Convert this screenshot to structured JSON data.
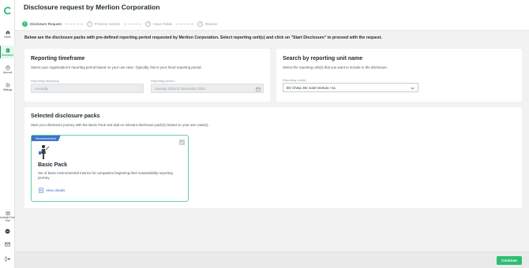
{
  "sidebar": {
    "items": [
      {
        "label": "Home",
        "icon": "home-icon"
      },
      {
        "label": "Disclosure",
        "icon": "disclosure-icon",
        "active": true
      },
      {
        "label": "Account",
        "icon": "account-icon"
      },
      {
        "label": "Settings",
        "icon": "settings-icon"
      }
    ],
    "bottom_items": [
      {
        "label": "Activate Free Trial",
        "icon": "gift-icon"
      },
      {
        "label": "",
        "icon": "chat-icon"
      },
      {
        "label": "",
        "icon": "mail-icon"
      },
      {
        "label": "",
        "icon": "logout-icon"
      }
    ]
  },
  "header": {
    "title": "Disclosure request by Merlion Corporation",
    "steps": [
      {
        "num": "1",
        "label": "Disclosure Request",
        "active": true
      },
      {
        "num": "2",
        "label": "Preview metrics"
      },
      {
        "num": "3",
        "label": "Input Fields"
      },
      {
        "num": "4",
        "label": "Review"
      }
    ]
  },
  "intro": "Below are the disclosure packs with pre-defined reporting period requested by Merlion Corporation. Select reporting unit(s) and click on \"Start Disclosure\" to proceed with the request.",
  "reporting_timeframe": {
    "title": "Reporting timeframe",
    "description": "Select your organisation's reporting period based on your use case. Typically, this is your fiscal reporting period.",
    "frequency_label": "Reporting frequency",
    "frequency_value": "Annually",
    "period_label": "Reporting period",
    "period_value": "January 2024 to December 2024"
  },
  "reporting_unit": {
    "title": "Search by reporting unit name",
    "description": "Select the reporting unit(s) that you want to include in the disclosure.",
    "units_label": "Reporting unit(s)",
    "units_value": "BV China, BV Joint Venture  +11"
  },
  "packs": {
    "title": "Selected disclosure packs",
    "description": "Start your disclosure journey with the Basic Pack and add on relevant disclosure pack(s) based on your use case(s).",
    "items": [
      {
        "badge": "Recommended",
        "name": "Basic Pack",
        "description": "Set of basic environmental metrics for companies beginning their sustainability reporting journey.",
        "link": "View details"
      }
    ]
  },
  "footer": {
    "continue_label": "Continue"
  },
  "colors": {
    "accent": "#2ebd74",
    "badge": "#3d73c9",
    "link": "#3d73c9"
  }
}
